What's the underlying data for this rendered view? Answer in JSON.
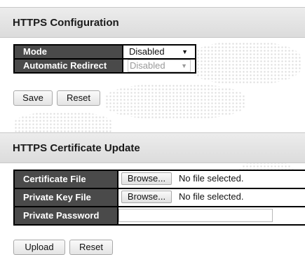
{
  "https_config": {
    "title": "HTTPS Configuration",
    "mode": {
      "label": "Mode",
      "value": "Disabled"
    },
    "automatic_redirect": {
      "label": "Automatic Redirect",
      "value": "Disabled"
    },
    "save_label": "Save",
    "reset_label": "Reset"
  },
  "cert_update": {
    "title": "HTTPS Certificate Update",
    "certificate_file": {
      "label": "Certificate File",
      "browse_label": "Browse...",
      "status": "No file selected."
    },
    "private_key_file": {
      "label": "Private Key File",
      "browse_label": "Browse...",
      "status": "No file selected."
    },
    "private_password": {
      "label": "Private Password",
      "value": ""
    },
    "upload_label": "Upload",
    "reset_label": "Reset"
  },
  "icons": {
    "dropdown": "chevron-down-icon"
  }
}
